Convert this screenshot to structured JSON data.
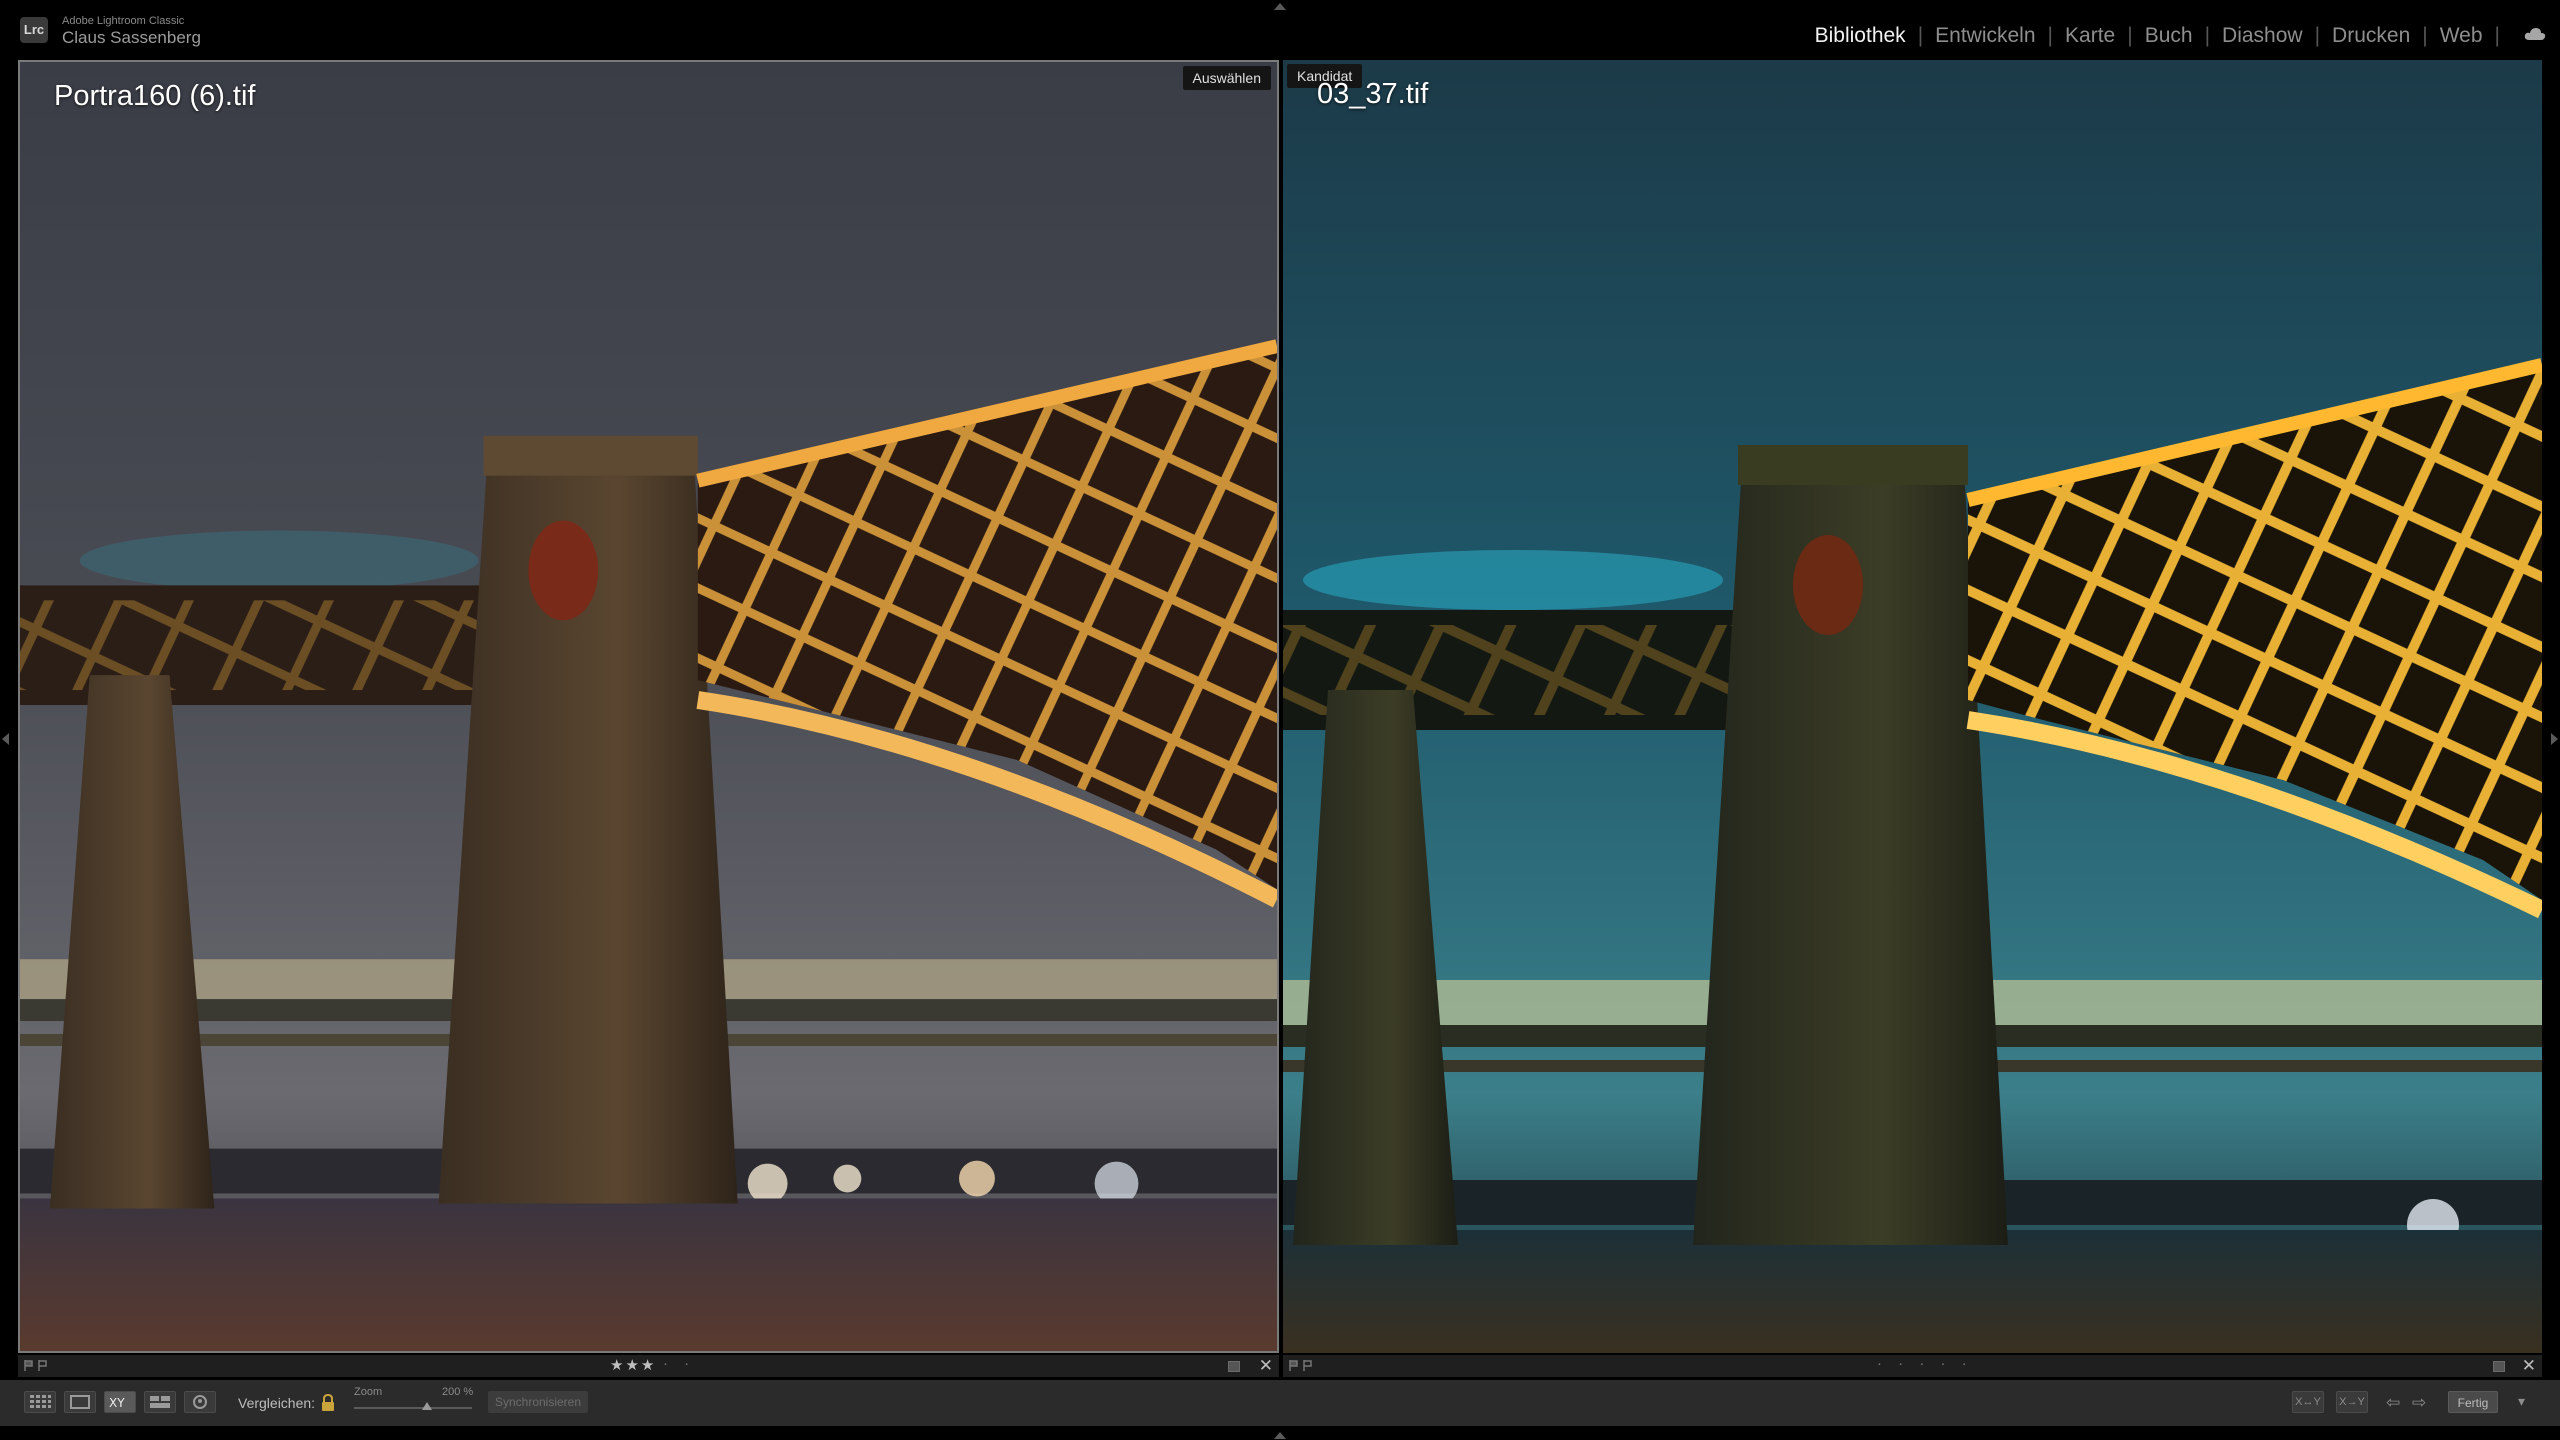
{
  "app": {
    "badge": "Lrc",
    "product": "Adobe Lightroom Classic",
    "user": "Claus Sassenberg"
  },
  "modules": [
    {
      "label": "Bibliothek",
      "active": true
    },
    {
      "label": "Entwickeln",
      "active": false
    },
    {
      "label": "Karte",
      "active": false
    },
    {
      "label": "Buch",
      "active": false
    },
    {
      "label": "Diashow",
      "active": false
    },
    {
      "label": "Drucken",
      "active": false
    },
    {
      "label": "Web",
      "active": false
    }
  ],
  "compare": {
    "select": {
      "tag": "Auswählen",
      "filename": "Portra160 (6).tif",
      "rating_stars": "★★★",
      "rating_dots": "· ·"
    },
    "candidate": {
      "tag": "Kandidat",
      "filename": "03_37.tif",
      "rating_dots": "· · · · ·"
    }
  },
  "toolbar": {
    "compare_label": "Vergleichen:",
    "zoom_label": "Zoom",
    "zoom_value": "200 %",
    "zoom_fraction": 0.62,
    "sync_label": "Synchronisieren",
    "swap_label": "X↔Y",
    "make_select_label": "X→Y",
    "done_label": "Fertig"
  },
  "icons": {
    "grid": "grid-view-icon",
    "loupe": "loupe-view-icon",
    "compare": "compare-view-icon",
    "survey": "survey-view-icon",
    "people": "people-view-icon",
    "lock": "lock-icon",
    "cloud": "cloud-icon"
  }
}
